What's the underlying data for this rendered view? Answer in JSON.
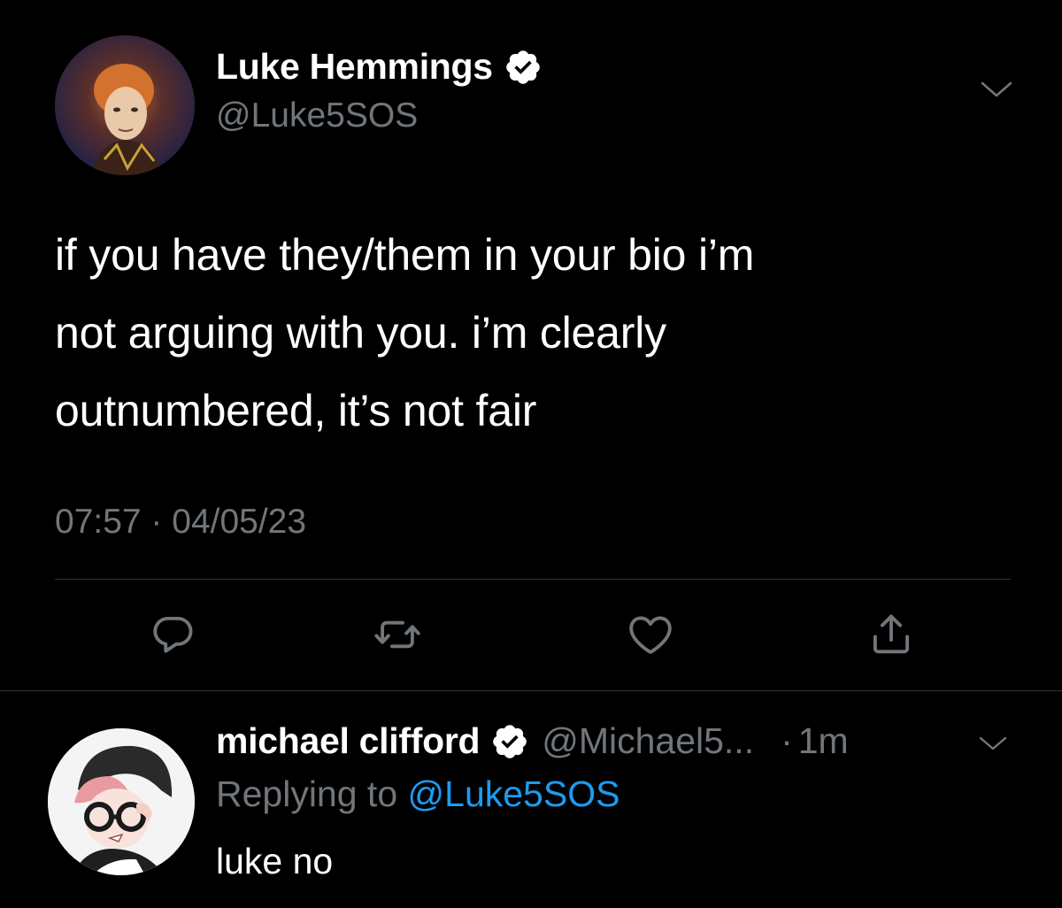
{
  "tweet": {
    "author_name": "Luke Hemmings",
    "author_handle": "@Luke5SOS",
    "verified": true,
    "text": "if you have they/them in your bio i’m\nnot arguing with you. i’m clearly\noutnumbered, it’s not fair",
    "timestamp": "07:57 · 04/05/23"
  },
  "actions": [
    {
      "name": "reply",
      "icon": "comment-icon"
    },
    {
      "name": "retweet",
      "icon": "retweet-icon"
    },
    {
      "name": "like",
      "icon": "heart-icon"
    },
    {
      "name": "share",
      "icon": "share-icon"
    }
  ],
  "reply": {
    "author_name": "michael clifford",
    "author_handle": "@Michael5...",
    "verified": true,
    "separator": "·",
    "time": "1m",
    "replying_prefix": "Replying to",
    "replying_handle": "@Luke5SOS",
    "text": "luke no"
  },
  "colors": {
    "background": "#000000",
    "text_primary": "#ffffff",
    "text_secondary": "#71767b",
    "accent_blue": "#1d9bf0",
    "divider": "#2f3336"
  }
}
